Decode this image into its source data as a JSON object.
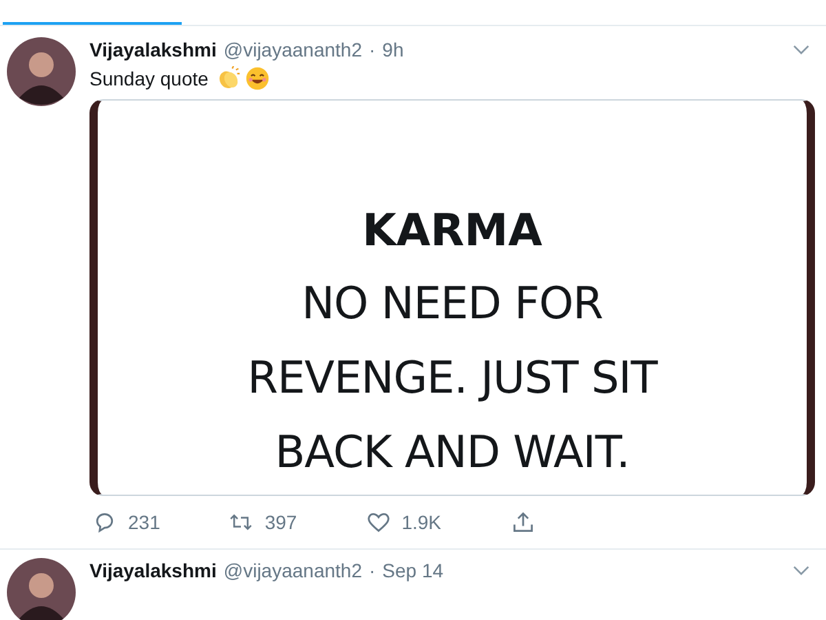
{
  "tweets": [
    {
      "author": "Vijayalakshmi",
      "handle": "@vijayaananth2",
      "separator": "·",
      "time": "9h",
      "text": "Sunday quote",
      "emojis": [
        {
          "kind": "clap"
        },
        {
          "kind": "smile"
        }
      ],
      "image": {
        "heading": "KARMA",
        "lines": [
          "NO NEED FOR",
          "REVENGE. JUST SIT",
          "BACK AND WAIT."
        ]
      },
      "replies": "231",
      "retweets": "397",
      "likes": "1.9K"
    },
    {
      "author": "Vijayalakshmi",
      "handle": "@vijayaananth2",
      "separator": "·",
      "time": "Sep 14"
    }
  ]
}
